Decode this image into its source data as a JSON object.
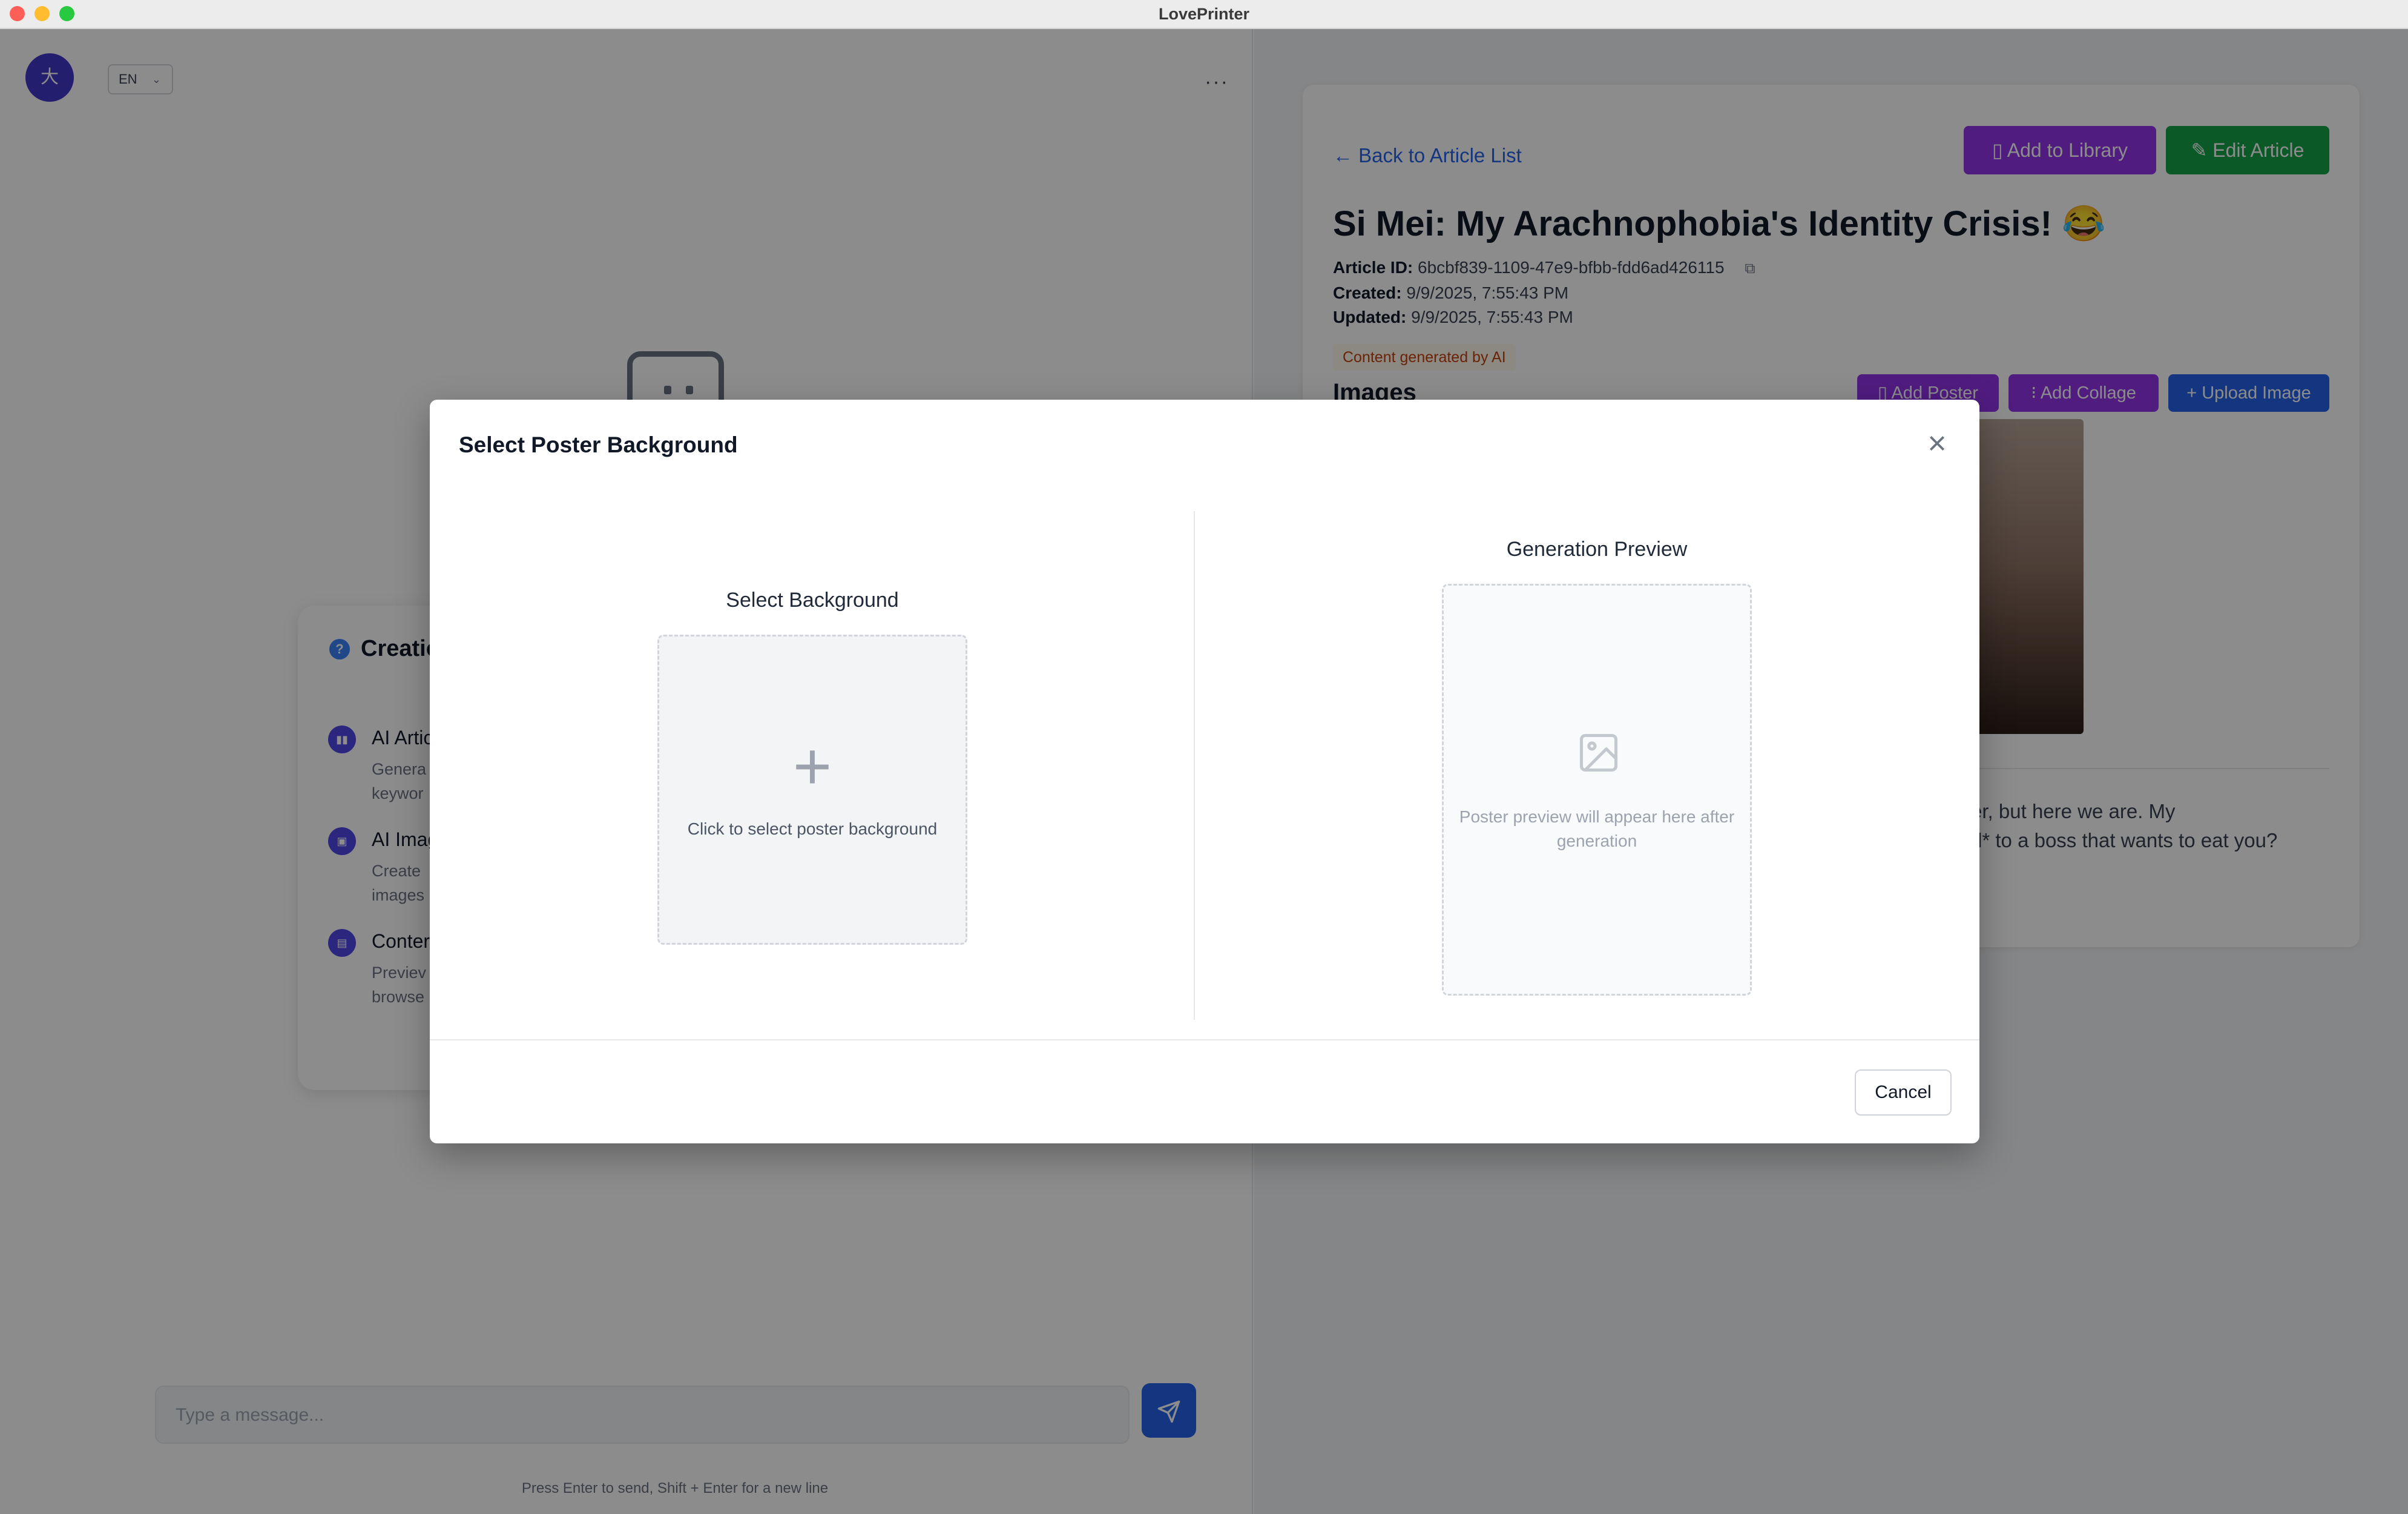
{
  "window": {
    "title": "LovePrinter"
  },
  "left": {
    "avatar_text": "大",
    "language": "EN",
    "more_label": "···",
    "guide": {
      "title": "Creatio",
      "items": [
        {
          "title": "AI Artic",
          "desc_line1": "Genera",
          "desc_line2": "keywor"
        },
        {
          "title": "AI Imag",
          "desc_line1": "Create",
          "desc_line2": "images"
        },
        {
          "title": "Conter",
          "desc_line1": "Previev",
          "desc_line2": "browse"
        }
      ]
    },
    "message_placeholder": "Type a message...",
    "hint": "Press Enter to send, Shift + Enter for a new line"
  },
  "article": {
    "back_label": "Back to Article List",
    "add_to_library": "Add to Library",
    "edit_article": "Edit Article",
    "title": "Si Mei: My Arachnophobia's Identity Crisis! 😂",
    "id_label": "Article ID:",
    "id_value": "6bcbf839-1109-47e9-bfbb-fdd6ad426115",
    "created_label": "Created:",
    "created_value": "9/9/2025, 7:55:43 PM",
    "updated_label": "Updated:",
    "updated_value": "9/9/2025, 7:55:43 PM",
    "ai_badge": "Content generated by AI",
    "images_title": "Images",
    "add_poster": "Add Poster",
    "add_collage": "Add Collage",
    "upload_image": "Upload Image",
    "excerpt_line1": "pider, but here we are. My",
    "excerpt_line2": "cted* to a boss that wants to eat you?"
  },
  "modal": {
    "title": "Select Poster Background",
    "select_background_label": "Select Background",
    "drop_text": "Click to select poster background",
    "preview_label": "Generation Preview",
    "preview_text": "Poster preview will appear here after generation",
    "cancel": "Cancel"
  },
  "colors": {
    "purple": "#9333ea",
    "green": "#16a34a",
    "blue": "#2563eb",
    "indigo": "#4338ca"
  }
}
